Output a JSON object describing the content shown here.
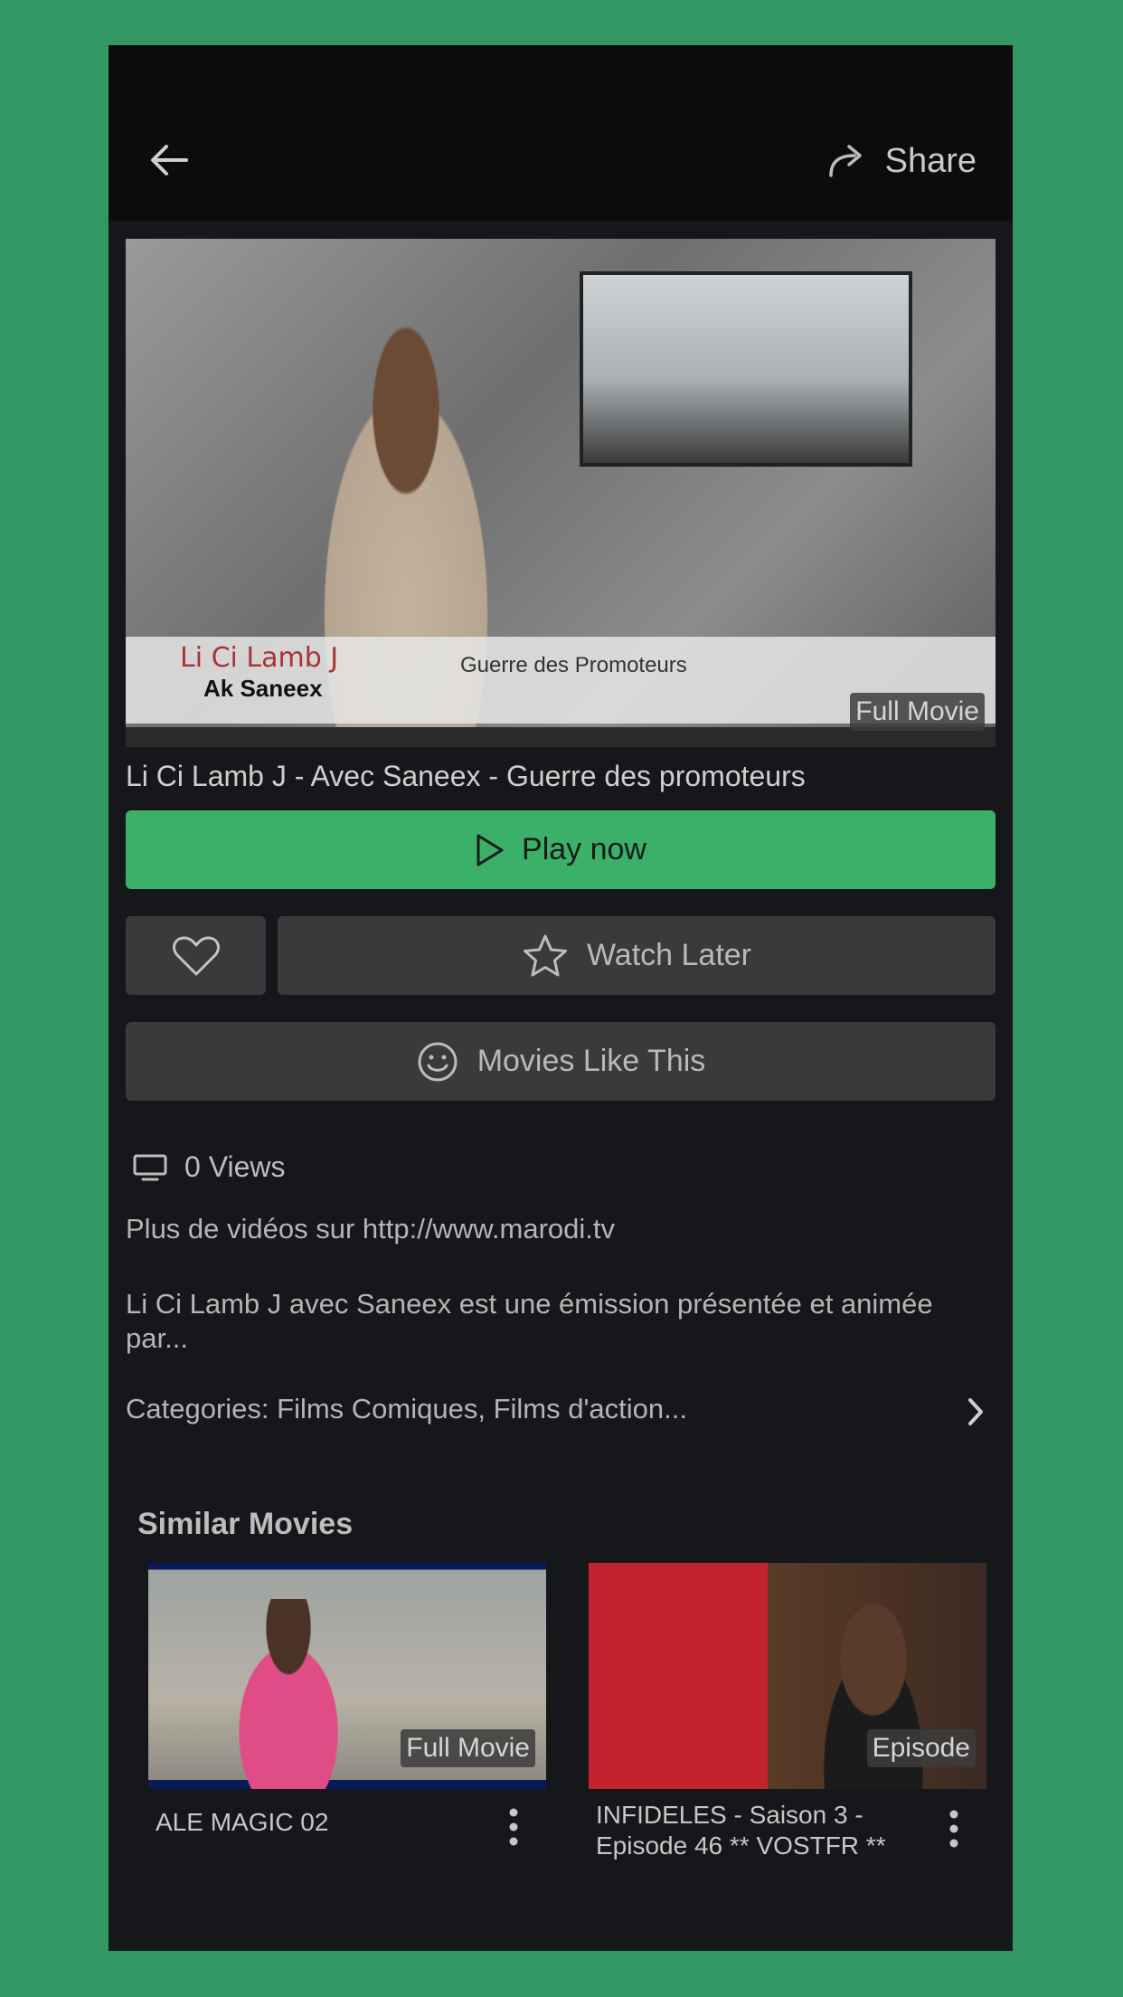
{
  "header": {
    "share_label": "Share"
  },
  "video": {
    "badge": "Full Movie",
    "title": "Li Ci Lamb J - Avec Saneex - Guerre des promoteurs",
    "overlay_name": "Li Ci Lamb J",
    "overlay_sub": "Ak Saneex",
    "overlay_caption": "Guerre des Promoteurs"
  },
  "actions": {
    "play_label": "Play now",
    "watch_later_label": "Watch Later",
    "movies_like_label": "Movies Like This"
  },
  "details": {
    "views": "0 Views",
    "source_line": "Plus de vidéos sur http://www.marodi.tv",
    "description": "Li Ci Lamb J avec Saneex est une émission présentée et animée par...",
    "categories": "Categories: Films Comiques, Films d'action..."
  },
  "similar": {
    "title": "Similar Movies",
    "items": [
      {
        "title": "ALE MAGIC 02",
        "badge": "Full Movie"
      },
      {
        "title": "INFIDELES - Saison 3 - Episode 46 ** VOSTFR **",
        "badge": "Episode"
      }
    ]
  },
  "colors": {
    "accent": "#3bb068",
    "background": "#329763",
    "surface": "#16171b",
    "button": "#3a3a3c"
  }
}
